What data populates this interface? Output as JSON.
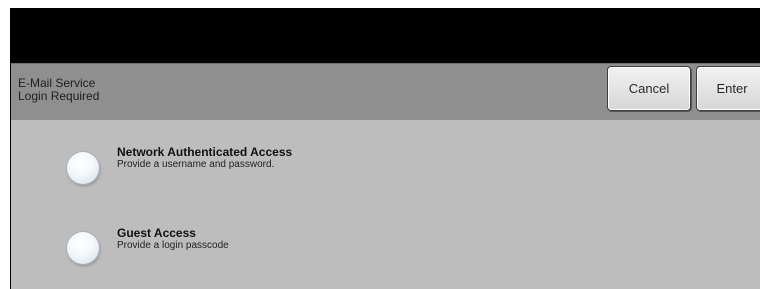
{
  "header": {
    "service": "E-Mail Service",
    "subtitle": "Login Required",
    "cancel_label": "Cancel",
    "enter_label": "Enter"
  },
  "options": [
    {
      "title": "Network Authenticated Access",
      "description": "Provide a username and password."
    },
    {
      "title": "Guest Access",
      "description": "Provide a login passcode"
    }
  ],
  "colors": {
    "top_bar": "#000000",
    "header_bar": "#8f8f8f",
    "content_bg": "#bdbdbd"
  }
}
